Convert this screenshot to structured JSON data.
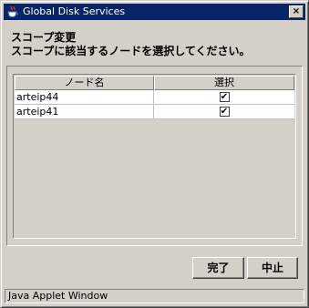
{
  "window": {
    "title": "Global Disk Services",
    "close_glyph": "×",
    "icon": "java-cup-icon"
  },
  "header": {
    "line1": "スコープ変更",
    "line2": "スコープに該当するノードを選択してください。"
  },
  "table": {
    "columns": [
      "ノード名",
      "選択"
    ],
    "rows": [
      {
        "node": "arteip44",
        "selected": true,
        "check_glyph": "✔"
      },
      {
        "node": "arteip41",
        "selected": true,
        "check_glyph": "✔"
      }
    ]
  },
  "buttons": {
    "finish": "完了",
    "cancel": "中止"
  },
  "status": {
    "text": "Java Applet Window"
  },
  "colors": {
    "titlebar": "#0a246a",
    "face": "#d4d0c8",
    "row_bg": "#ffffff"
  }
}
